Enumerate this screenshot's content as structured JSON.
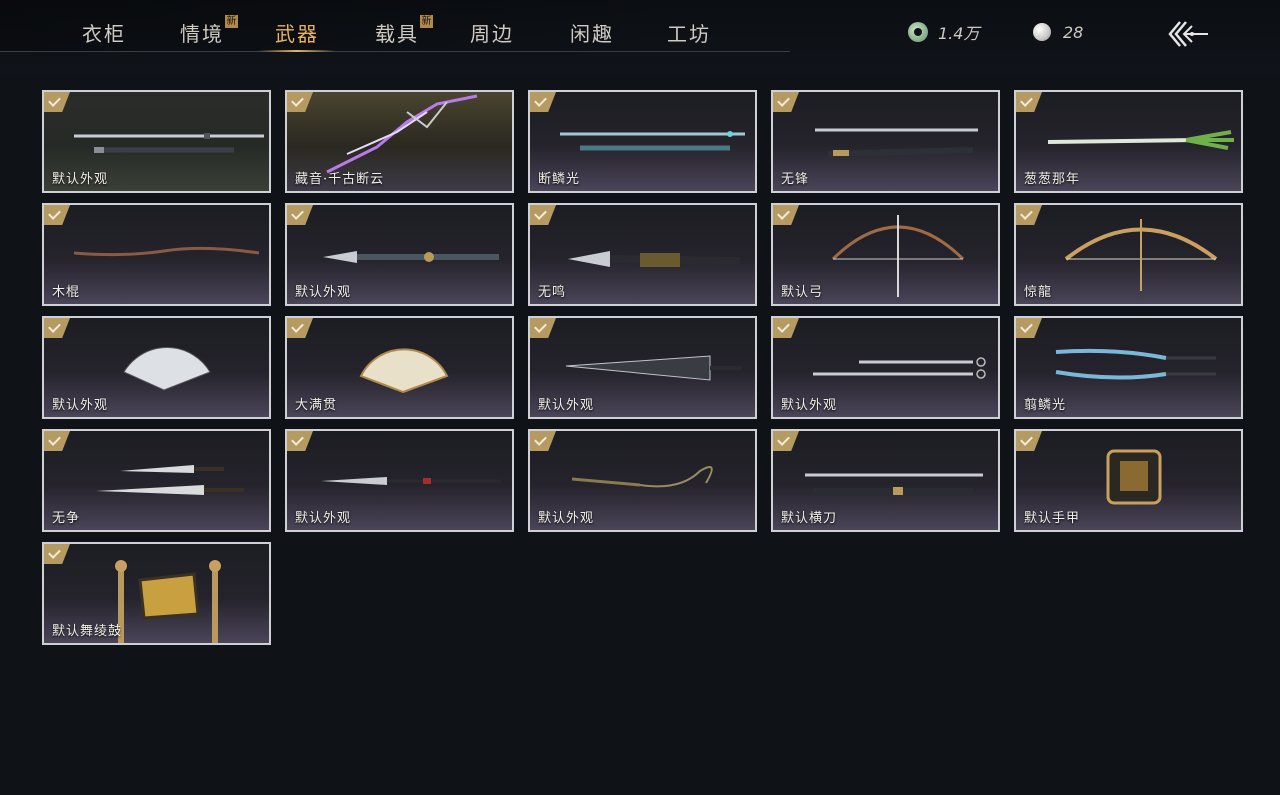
{
  "tabs": [
    {
      "label": "衣柜",
      "is_new": false,
      "active": false
    },
    {
      "label": "情境",
      "is_new": true,
      "active": false
    },
    {
      "label": "武器",
      "is_new": false,
      "active": true
    },
    {
      "label": "载具",
      "is_new": true,
      "active": false
    },
    {
      "label": "周边",
      "is_new": false,
      "active": false
    },
    {
      "label": "闲趣",
      "is_new": false,
      "active": false
    },
    {
      "label": "工坊",
      "is_new": false,
      "active": false
    }
  ],
  "new_badge": "新",
  "currency": {
    "jade": {
      "icon": "jade-coin-icon",
      "value": "1.4万"
    },
    "pearl": {
      "icon": "pearl-icon",
      "value": "28"
    }
  },
  "back_icon": "back-arrow-icon",
  "accent_color": "#e8b45c",
  "items": [
    {
      "label": "默认外观",
      "art": "sword-pair",
      "owned": true
    },
    {
      "label": "藏音·千古断云",
      "art": "lightning-sword",
      "owned": true
    },
    {
      "label": "断鳞光",
      "art": "jade-sword",
      "owned": true
    },
    {
      "label": "无锋",
      "art": "dark-sword",
      "owned": true
    },
    {
      "label": "葱葱那年",
      "art": "scallion",
      "owned": true
    },
    {
      "label": "木棍",
      "art": "wood-stick",
      "owned": true
    },
    {
      "label": "默认外观",
      "art": "spear",
      "owned": true
    },
    {
      "label": "无鸣",
      "art": "ornate-spear",
      "owned": true
    },
    {
      "label": "默认弓",
      "art": "bow",
      "owned": true
    },
    {
      "label": "惊龍",
      "art": "dragon-bow",
      "owned": true
    },
    {
      "label": "默认外观",
      "art": "fan",
      "owned": true
    },
    {
      "label": "大满贯",
      "art": "gold-fan",
      "owned": true
    },
    {
      "label": "默认外观",
      "art": "umbrella",
      "owned": true
    },
    {
      "label": "默认外观",
      "art": "dual-blades",
      "owned": true
    },
    {
      "label": "翦鳞光",
      "art": "dual-jade-blades",
      "owned": true
    },
    {
      "label": "无争",
      "art": "dual-broadswords",
      "owned": true
    },
    {
      "label": "默认外观",
      "art": "long-spear",
      "owned": true
    },
    {
      "label": "默认外观",
      "art": "rope-dart",
      "owned": true
    },
    {
      "label": "默认横刀",
      "art": "hengdao",
      "owned": true
    },
    {
      "label": "默认手甲",
      "art": "gauntlet",
      "owned": true
    },
    {
      "label": "默认舞绫鼓",
      "art": "dance-drum",
      "owned": true
    }
  ]
}
